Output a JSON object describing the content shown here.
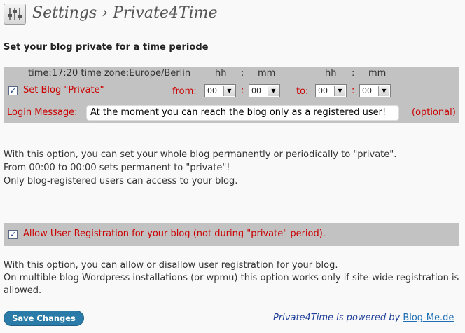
{
  "header": {
    "title": "Settings › Private4Time"
  },
  "private_section": {
    "heading": "Set your blog private for a time periode",
    "time_info": "time:17:20 time zone:Europe/Berlin",
    "hh1": "hh",
    "sep1": ":",
    "mm1": "mm",
    "hh2": "hh",
    "sep2": ":",
    "mm2": "mm",
    "set_private_label": "Set Blog \"Private\"",
    "set_private_checked": true,
    "from_label": "from:",
    "to_label": "to:",
    "colon": ":",
    "from_hh": "00",
    "from_mm": "00",
    "to_hh": "00",
    "to_mm": "00",
    "login_message_label": "Login Message:",
    "login_message_value": "At the moment you can reach the blog only as a registered user!",
    "optional_label": "(optional)",
    "help_lines": [
      "With this option, you can set your whole blog permanently or periodically to \"private\".",
      "From 00:00 to 00:00 sets permanent to \"private\"!",
      "Only blog-registered users can access to your blog."
    ]
  },
  "registration_section": {
    "allow_label": "Allow User Registration for your blog (not during \"private\" period).",
    "allow_checked": true,
    "help_lines": [
      "With this option, you can allow or disallow user registration for your blog.",
      "On multible blog Wordpress installations (or wpmu) this option works only if site-wide registration is",
      "allowed."
    ]
  },
  "footer": {
    "save_label": "Save Changes",
    "powered_text": "Private4Time is powered by ",
    "powered_link": "Blog-Me.de"
  }
}
